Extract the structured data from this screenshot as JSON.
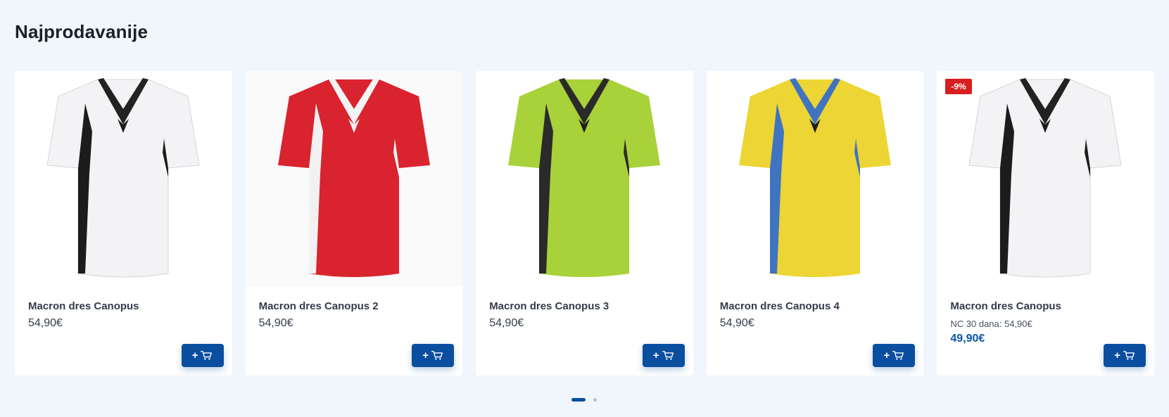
{
  "section": {
    "title": "Najprodavanije"
  },
  "products": [
    {
      "name": "Macron dres Canopus",
      "price": "54,90€",
      "cart_label": "+",
      "colors": {
        "body": "#f3f3f5",
        "accent": "#1c1c1c",
        "collar": "#222222"
      }
    },
    {
      "name": "Macron dres Canopus 2",
      "price": "54,90€",
      "cart_label": "+",
      "colors": {
        "body": "#d9232e",
        "accent": "#f1f1f1",
        "collar": "#f4f4f4"
      }
    },
    {
      "name": "Macron dres Canopus 3",
      "price": "54,90€",
      "cart_label": "+",
      "colors": {
        "body": "#a9d13a",
        "accent": "#2a2a2a",
        "collar": "#2a2a2a"
      }
    },
    {
      "name": "Macron dres Canopus 4",
      "price": "54,90€",
      "cart_label": "+",
      "colors": {
        "body": "#ecd534",
        "accent": "#3f74c0",
        "collar": "#3f74c0"
      }
    },
    {
      "name": "Macron dres Canopus",
      "discount_badge": "-9%",
      "old_price": "NC 30 dana: 54,90€",
      "price": "49,90€",
      "cart_label": "+",
      "colors": {
        "body": "#f3f3f5",
        "accent": "#1c1c1c",
        "collar": "#222222"
      }
    }
  ],
  "icons": {
    "cart": "cart-icon",
    "logo": "macron-logo-icon"
  },
  "pager": {
    "active_index": 0,
    "count": 2
  },
  "theme": {
    "primary": "#0a4ea0",
    "sale_price": "#0a56a8",
    "badge": "#d71f1f",
    "background": "#f1f5fc"
  }
}
